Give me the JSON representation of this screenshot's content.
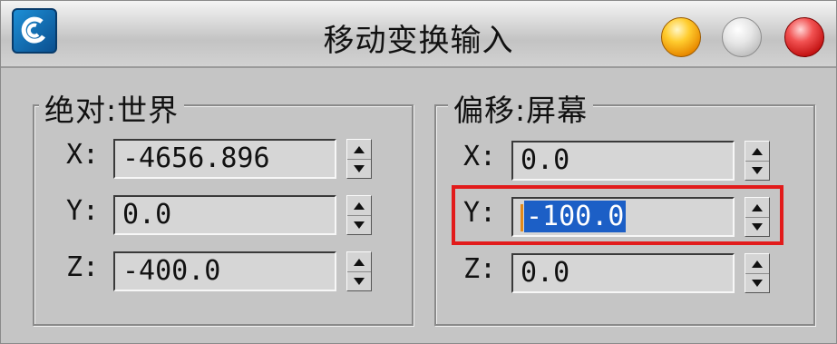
{
  "window": {
    "title": "移动变换输入",
    "icons": {
      "app": "3dsmax-logo-icon",
      "minimize": "minimize-button",
      "maximize": "maximize-button",
      "close": "close-button"
    }
  },
  "absolute_world": {
    "legend": "绝对:世界",
    "x": {
      "label": "X:",
      "value": "-4656.896"
    },
    "y": {
      "label": "Y:",
      "value": "0.0"
    },
    "z": {
      "label": "Z:",
      "value": "-400.0"
    }
  },
  "offset_screen": {
    "legend": "偏移:屏幕",
    "x": {
      "label": "X:",
      "value": "0.0"
    },
    "y": {
      "label": "Y:",
      "value": "-100.0"
    },
    "z": {
      "label": "Z:",
      "value": "0.0"
    }
  },
  "colors": {
    "selection": "#1c5fc6",
    "highlight_box": "#e21b1b"
  }
}
